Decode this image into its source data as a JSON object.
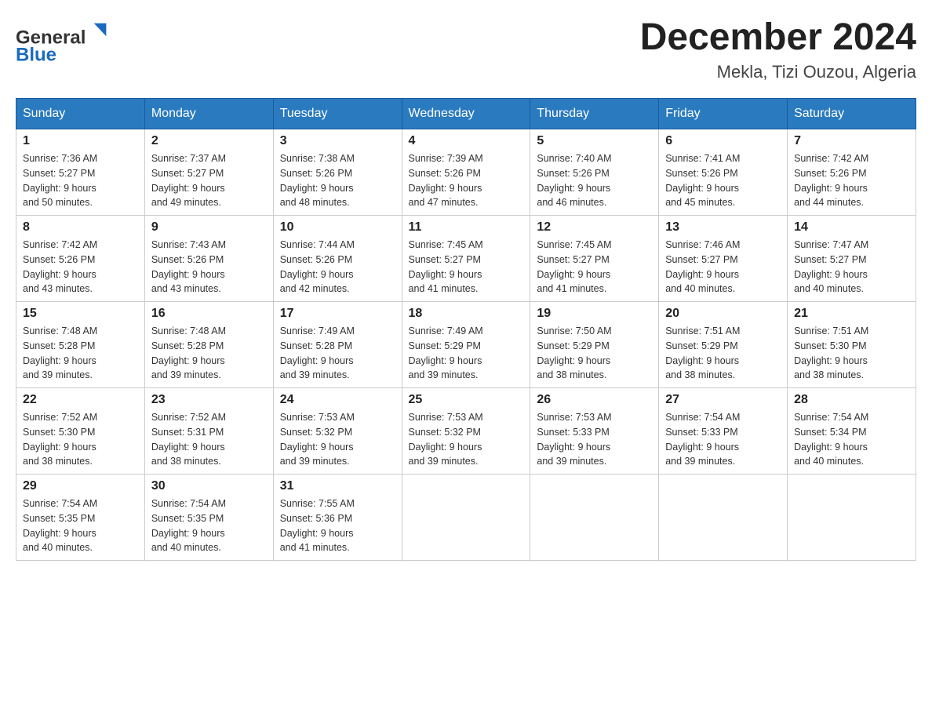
{
  "header": {
    "logo_general": "General",
    "logo_blue": "Blue",
    "month_title": "December 2024",
    "location": "Mekla, Tizi Ouzou, Algeria"
  },
  "weekdays": [
    "Sunday",
    "Monday",
    "Tuesday",
    "Wednesday",
    "Thursday",
    "Friday",
    "Saturday"
  ],
  "weeks": [
    [
      {
        "day": "1",
        "sunrise": "7:36 AM",
        "sunset": "5:27 PM",
        "daylight": "9 hours and 50 minutes."
      },
      {
        "day": "2",
        "sunrise": "7:37 AM",
        "sunset": "5:27 PM",
        "daylight": "9 hours and 49 minutes."
      },
      {
        "day": "3",
        "sunrise": "7:38 AM",
        "sunset": "5:26 PM",
        "daylight": "9 hours and 48 minutes."
      },
      {
        "day": "4",
        "sunrise": "7:39 AM",
        "sunset": "5:26 PM",
        "daylight": "9 hours and 47 minutes."
      },
      {
        "day": "5",
        "sunrise": "7:40 AM",
        "sunset": "5:26 PM",
        "daylight": "9 hours and 46 minutes."
      },
      {
        "day": "6",
        "sunrise": "7:41 AM",
        "sunset": "5:26 PM",
        "daylight": "9 hours and 45 minutes."
      },
      {
        "day": "7",
        "sunrise": "7:42 AM",
        "sunset": "5:26 PM",
        "daylight": "9 hours and 44 minutes."
      }
    ],
    [
      {
        "day": "8",
        "sunrise": "7:42 AM",
        "sunset": "5:26 PM",
        "daylight": "9 hours and 43 minutes."
      },
      {
        "day": "9",
        "sunrise": "7:43 AM",
        "sunset": "5:26 PM",
        "daylight": "9 hours and 43 minutes."
      },
      {
        "day": "10",
        "sunrise": "7:44 AM",
        "sunset": "5:26 PM",
        "daylight": "9 hours and 42 minutes."
      },
      {
        "day": "11",
        "sunrise": "7:45 AM",
        "sunset": "5:27 PM",
        "daylight": "9 hours and 41 minutes."
      },
      {
        "day": "12",
        "sunrise": "7:45 AM",
        "sunset": "5:27 PM",
        "daylight": "9 hours and 41 minutes."
      },
      {
        "day": "13",
        "sunrise": "7:46 AM",
        "sunset": "5:27 PM",
        "daylight": "9 hours and 40 minutes."
      },
      {
        "day": "14",
        "sunrise": "7:47 AM",
        "sunset": "5:27 PM",
        "daylight": "9 hours and 40 minutes."
      }
    ],
    [
      {
        "day": "15",
        "sunrise": "7:48 AM",
        "sunset": "5:28 PM",
        "daylight": "9 hours and 39 minutes."
      },
      {
        "day": "16",
        "sunrise": "7:48 AM",
        "sunset": "5:28 PM",
        "daylight": "9 hours and 39 minutes."
      },
      {
        "day": "17",
        "sunrise": "7:49 AM",
        "sunset": "5:28 PM",
        "daylight": "9 hours and 39 minutes."
      },
      {
        "day": "18",
        "sunrise": "7:49 AM",
        "sunset": "5:29 PM",
        "daylight": "9 hours and 39 minutes."
      },
      {
        "day": "19",
        "sunrise": "7:50 AM",
        "sunset": "5:29 PM",
        "daylight": "9 hours and 38 minutes."
      },
      {
        "day": "20",
        "sunrise": "7:51 AM",
        "sunset": "5:29 PM",
        "daylight": "9 hours and 38 minutes."
      },
      {
        "day": "21",
        "sunrise": "7:51 AM",
        "sunset": "5:30 PM",
        "daylight": "9 hours and 38 minutes."
      }
    ],
    [
      {
        "day": "22",
        "sunrise": "7:52 AM",
        "sunset": "5:30 PM",
        "daylight": "9 hours and 38 minutes."
      },
      {
        "day": "23",
        "sunrise": "7:52 AM",
        "sunset": "5:31 PM",
        "daylight": "9 hours and 38 minutes."
      },
      {
        "day": "24",
        "sunrise": "7:53 AM",
        "sunset": "5:32 PM",
        "daylight": "9 hours and 39 minutes."
      },
      {
        "day": "25",
        "sunrise": "7:53 AM",
        "sunset": "5:32 PM",
        "daylight": "9 hours and 39 minutes."
      },
      {
        "day": "26",
        "sunrise": "7:53 AM",
        "sunset": "5:33 PM",
        "daylight": "9 hours and 39 minutes."
      },
      {
        "day": "27",
        "sunrise": "7:54 AM",
        "sunset": "5:33 PM",
        "daylight": "9 hours and 39 minutes."
      },
      {
        "day": "28",
        "sunrise": "7:54 AM",
        "sunset": "5:34 PM",
        "daylight": "9 hours and 40 minutes."
      }
    ],
    [
      {
        "day": "29",
        "sunrise": "7:54 AM",
        "sunset": "5:35 PM",
        "daylight": "9 hours and 40 minutes."
      },
      {
        "day": "30",
        "sunrise": "7:54 AM",
        "sunset": "5:35 PM",
        "daylight": "9 hours and 40 minutes."
      },
      {
        "day": "31",
        "sunrise": "7:55 AM",
        "sunset": "5:36 PM",
        "daylight": "9 hours and 41 minutes."
      },
      null,
      null,
      null,
      null
    ]
  ]
}
